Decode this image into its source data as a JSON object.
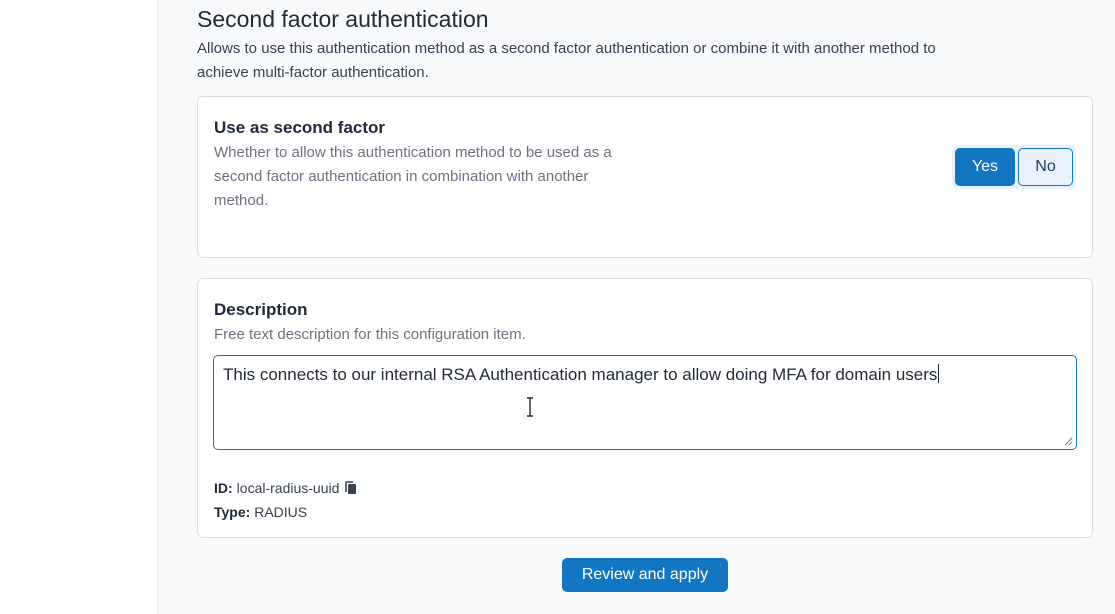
{
  "section": {
    "title": "Second factor authentication",
    "description": "Allows to use this authentication method as a second factor authentication or combine it with another method to achieve multi-factor authentication."
  },
  "second_factor": {
    "title": "Use as second factor",
    "description": "Whether to allow this authentication method to be used as a second factor authentication in combination with another method.",
    "yes_label": "Yes",
    "no_label": "No",
    "selected": "Yes"
  },
  "description_field": {
    "title": "Description",
    "help": "Free text description for this configuration item.",
    "value": "This connects to our internal RSA Authentication manager to allow doing MFA for domain users"
  },
  "meta": {
    "id_label": "ID:",
    "id_value": "local-radius-uuid",
    "type_label": "Type:",
    "type_value": "RADIUS"
  },
  "actions": {
    "review_label": "Review and apply"
  },
  "colors": {
    "accent": "#1276c3",
    "toggle_bg": "#e8f1fb",
    "page_bg": "#f8f9fb"
  },
  "icons": {
    "copy": "copy-icon",
    "text_cursor": "text-cursor-icon",
    "resize": "resize-handle-icon"
  }
}
